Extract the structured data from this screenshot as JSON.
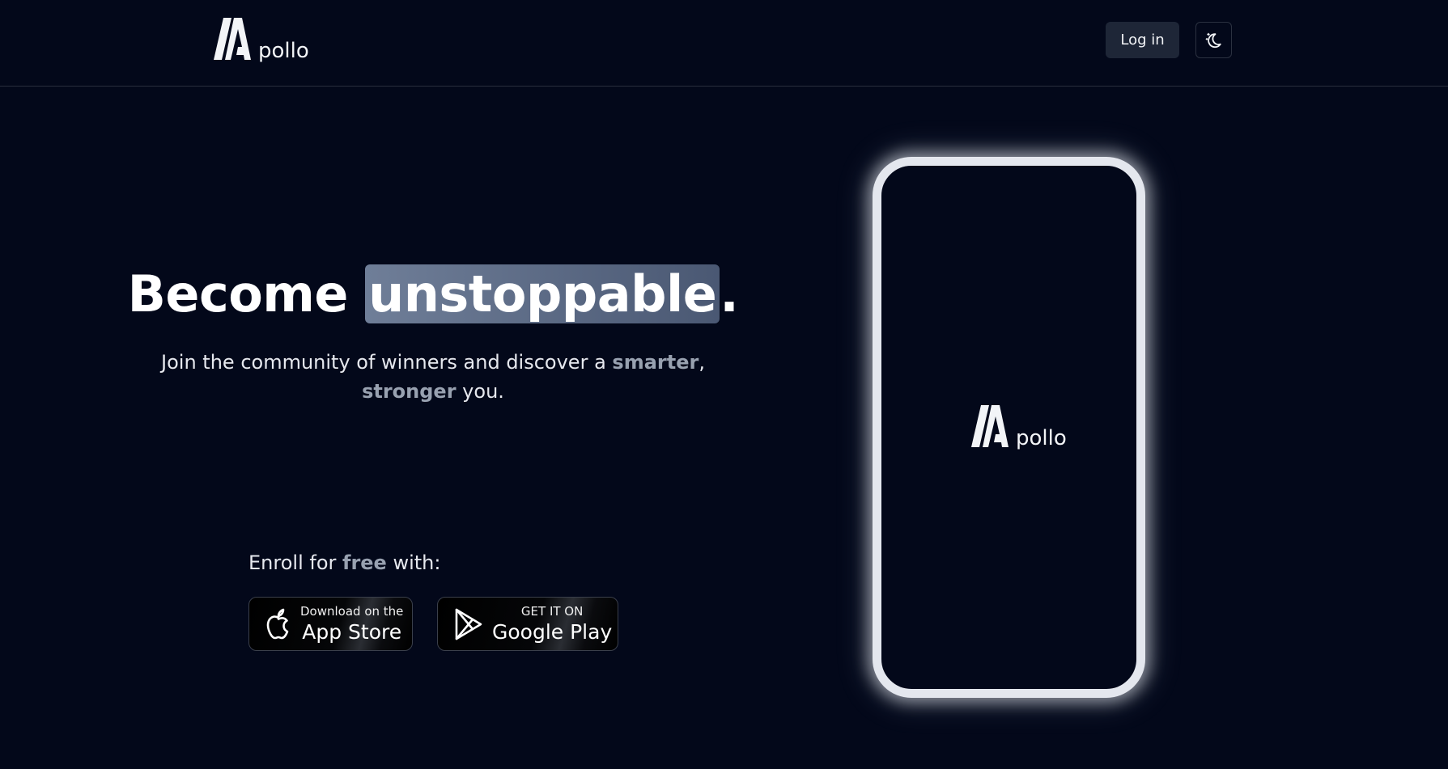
{
  "nav": {
    "logo_text": "pollo",
    "login_label": "Log in",
    "theme_toggle_icon": "moon-stars-icon"
  },
  "hero": {
    "title_prefix": "Become ",
    "title_highlight": "unstoppable",
    "title_suffix": ".",
    "subtitle_part1": "Join the community of winners and discover a ",
    "subtitle_accent1": "smarter",
    "subtitle_part2": ", ",
    "subtitle_accent2": "stronger",
    "subtitle_part3": " you."
  },
  "enroll": {
    "prefix": "Enroll for ",
    "accent": "free",
    "suffix": " with:"
  },
  "stores": {
    "appstore": {
      "small": "Download on the",
      "big": "App Store",
      "icon": "apple-icon"
    },
    "googleplay": {
      "small": "GET IT ON",
      "big": "Google Play",
      "icon": "play-icon"
    }
  },
  "phone": {
    "logo_text": "pollo"
  },
  "colors": {
    "background": "#03081a",
    "highlight": "#5e6b84",
    "accent_text": "#98a1b0",
    "phone_frame": "#e4e7ee"
  }
}
